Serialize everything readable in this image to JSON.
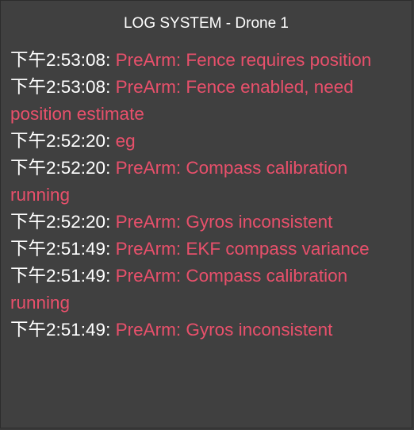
{
  "window": {
    "title": "LOG SYSTEM - Drone 1"
  },
  "colors": {
    "background": "#404040",
    "time_text": "#ffffff",
    "message_text": "#e8506b"
  },
  "logs": [
    {
      "time": "下午2:53:08:",
      "message": "PreArm: Fence requires position"
    },
    {
      "time": "下午2:53:08:",
      "message": "PreArm: Fence enabled, need position estimate"
    },
    {
      "time": "下午2:52:20:",
      "message": "eg"
    },
    {
      "time": "下午2:52:20:",
      "message": "PreArm: Compass calibration running"
    },
    {
      "time": "下午2:52:20:",
      "message": "PreArm: Gyros inconsistent"
    },
    {
      "time": "下午2:51:49:",
      "message": "PreArm: EKF compass variance"
    },
    {
      "time": "下午2:51:49:",
      "message": "PreArm: Compass calibration running"
    },
    {
      "time": "下午2:51:49:",
      "message": "PreArm: Gyros inconsistent"
    }
  ]
}
